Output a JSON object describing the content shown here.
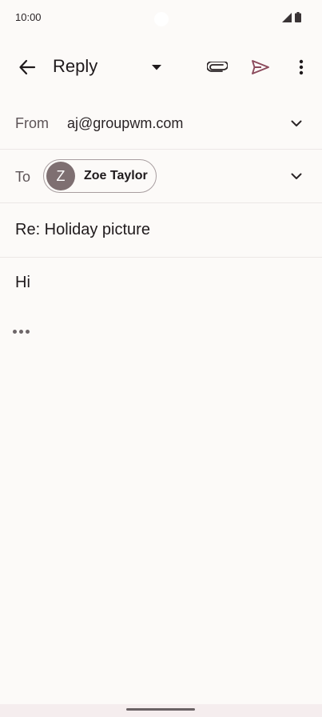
{
  "status": {
    "time": "10:00"
  },
  "app_bar": {
    "title": "Reply",
    "icons": [
      "back-arrow-icon",
      "dropdown-caret-icon",
      "paperclip-icon",
      "send-icon",
      "more-vert-icon"
    ],
    "send_color": "#8b4a5c"
  },
  "from": {
    "label": "From",
    "value": "aj@groupwm.com"
  },
  "to": {
    "label": "To",
    "chip": {
      "initial": "Z",
      "name": "Zoe Taylor",
      "avatar_color": "#7e6f71"
    }
  },
  "subject": {
    "value": "Re: Holiday picture"
  },
  "body": {
    "text": "Hi"
  }
}
